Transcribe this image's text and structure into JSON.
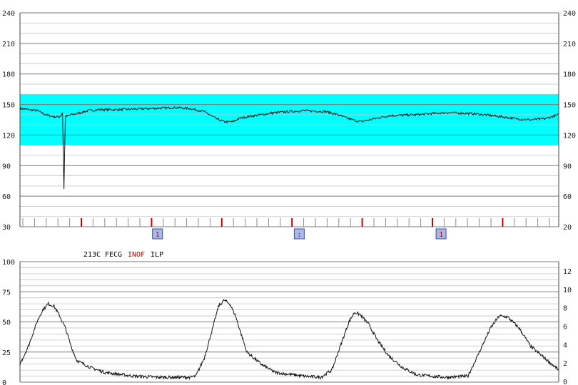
{
  "chart_data": [
    {
      "type": "line",
      "name": "fhr",
      "ylim": [
        30,
        240
      ],
      "yticks": [
        "240",
        "210",
        "180",
        "150",
        "120",
        "90",
        "60",
        "30"
      ],
      "right_yticks": [
        "240",
        "210",
        "180",
        "150",
        "120",
        "90",
        "60",
        "20"
      ],
      "band": [
        110,
        160
      ],
      "grid": true,
      "x_minutes": 19,
      "series": [
        {
          "x": [
            0,
            0.3,
            0.6,
            0.9,
            1.2,
            1.4,
            1.5,
            1.55,
            1.6,
            1.8,
            2.0,
            2.4,
            2.8,
            3.5,
            4.5,
            5.5,
            6.0,
            6.5,
            6.8,
            7.0,
            7.2,
            7.5,
            7.7,
            8.0,
            8.5,
            9.0,
            10.0,
            10.8,
            11.2,
            11.6,
            12.0,
            12.5,
            13.0,
            14.0,
            15.0,
            16.0,
            17.0,
            17.5,
            18.0,
            18.5,
            19.0
          ],
          "y": [
            146,
            145,
            144,
            140,
            138,
            138,
            142,
            67,
            138,
            140,
            141,
            144,
            145,
            145,
            146,
            147,
            146,
            143,
            138,
            135,
            133,
            133,
            136,
            138,
            140,
            142,
            144,
            143,
            140,
            136,
            133,
            136,
            139,
            140,
            142,
            141,
            138,
            136,
            135,
            136,
            140
          ]
        }
      ],
      "markers": [
        {
          "x": 4.85,
          "label": "1"
        },
        {
          "x": 9.85,
          "label": ":"
        },
        {
          "x": 14.85,
          "label": "1"
        }
      ]
    },
    {
      "type": "line",
      "name": "toco",
      "header": {
        "time": "213C",
        "mode": "FECG",
        "alert": "INOF",
        "extra": "ILP"
      },
      "ylim": [
        0,
        100
      ],
      "yticks": [
        "100",
        "75",
        "50",
        "25",
        "0"
      ],
      "right_yticks": [
        "12",
        "10",
        "8",
        "6",
        "4",
        "2",
        "0"
      ],
      "grid": true,
      "x_minutes": 19,
      "series": [
        {
          "x": [
            0,
            0.3,
            0.6,
            0.8,
            1.0,
            1.2,
            1.4,
            1.6,
            1.8,
            2.0,
            2.5,
            3.0,
            4.0,
            5.0,
            6.0,
            6.2,
            6.5,
            6.8,
            7.0,
            7.2,
            7.4,
            7.6,
            7.8,
            8.0,
            8.5,
            9.0,
            10.0,
            10.6,
            11.0,
            11.3,
            11.6,
            11.8,
            12.0,
            12.3,
            12.6,
            13.0,
            13.5,
            14.0,
            15.0,
            15.8,
            16.2,
            16.6,
            16.9,
            17.2,
            17.6,
            18.0,
            18.5,
            19.0
          ],
          "y": [
            15,
            30,
            50,
            60,
            65,
            63,
            55,
            45,
            30,
            18,
            12,
            8,
            5,
            4,
            4,
            5,
            20,
            45,
            63,
            68,
            65,
            55,
            40,
            25,
            15,
            8,
            5,
            4,
            10,
            30,
            50,
            58,
            56,
            48,
            35,
            22,
            12,
            6,
            4,
            5,
            25,
            45,
            55,
            54,
            45,
            30,
            20,
            10
          ]
        }
      ]
    }
  ]
}
